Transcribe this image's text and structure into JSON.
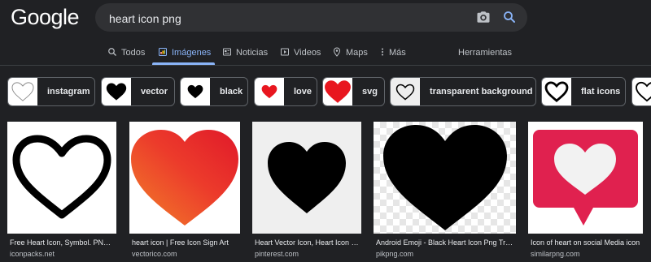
{
  "logo": "Google",
  "search": {
    "query": "heart icon png"
  },
  "tabs": [
    {
      "label": "Todos",
      "icon": "search-icon"
    },
    {
      "label": "Imágenes",
      "icon": "image-icon",
      "active": true
    },
    {
      "label": "Noticias",
      "icon": "news-icon"
    },
    {
      "label": "Videos",
      "icon": "play-icon"
    },
    {
      "label": "Maps",
      "icon": "map-pin-icon"
    },
    {
      "label": "Más",
      "icon": "more-vert-icon"
    }
  ],
  "tools_label": "Herramientas",
  "chips": [
    {
      "label": "instagram"
    },
    {
      "label": "vector"
    },
    {
      "label": "black"
    },
    {
      "label": "love"
    },
    {
      "label": "svg"
    },
    {
      "label": "transparent background"
    },
    {
      "label": "flat icons"
    }
  ],
  "results": [
    {
      "title": "Free Heart Icon, Symbol. PNG, SVG Download.",
      "source": "iconpacks.net"
    },
    {
      "title": "heart icon | Free Icon Sign Art",
      "source": "vectorico.com"
    },
    {
      "title": "Heart Vector Icon, Heart Icon PNG",
      "source": "pinterest.com"
    },
    {
      "title": "Android Emoji - Black Heart Icon Png Transparent",
      "source": "pikpng.com"
    },
    {
      "title": "Icon of heart on social Media icon",
      "source": "similarpng.com"
    }
  ],
  "colors": {
    "background": "#202124",
    "accent": "#8ab4f8",
    "heart_red": "#e8161f",
    "card_pink": "#e0214f"
  }
}
